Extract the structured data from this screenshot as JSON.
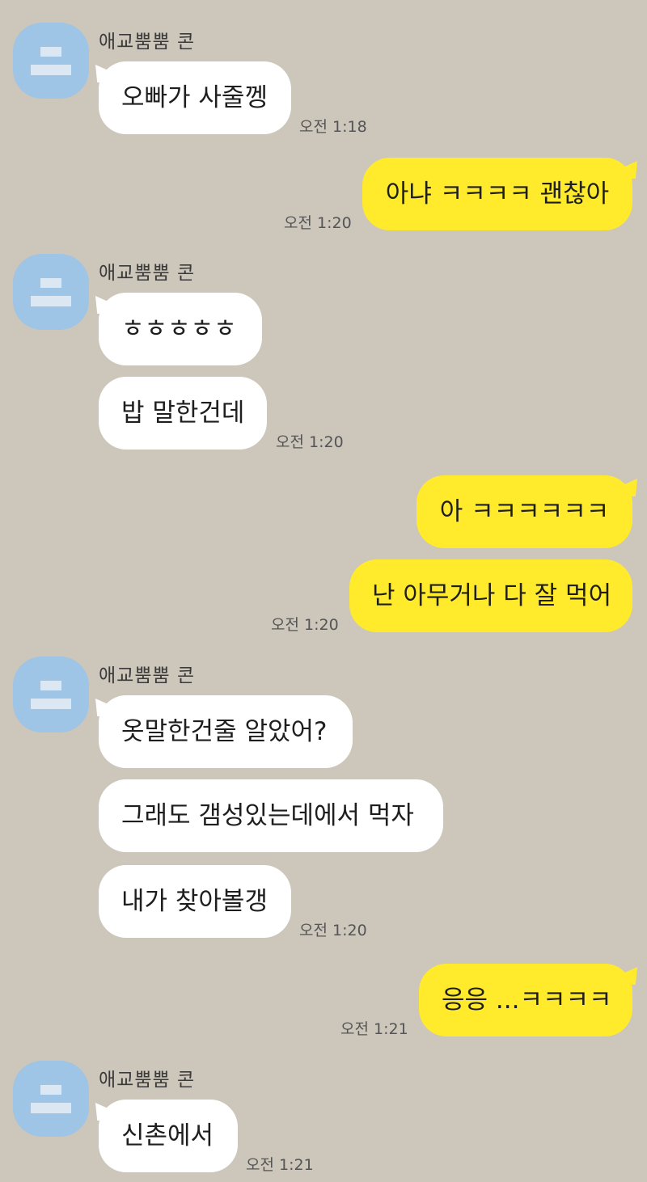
{
  "chat": {
    "sender_name": "애교뿜뿜 콘",
    "colors": {
      "background": "#ccc6bb",
      "incoming_bubble": "#ffffff",
      "outgoing_bubble": "#ffea2c",
      "avatar": "#9ec4e6"
    },
    "messages": [
      {
        "dir": "in",
        "text": "오빠가 사줄껭"
      },
      {
        "dir": "in_time",
        "text": "오전 1:18"
      },
      {
        "dir": "out",
        "text": "아냐 ㅋㅋㅋㅋ 괜찮아"
      },
      {
        "dir": "out_time",
        "text": "오전 1:20"
      },
      {
        "dir": "in",
        "text": "ㅎㅎㅎㅎㅎ"
      },
      {
        "dir": "in",
        "text": "밥 말한건데"
      },
      {
        "dir": "in_time",
        "text": "오전 1:20"
      },
      {
        "dir": "out",
        "text": "아 ㅋㅋㅋㅋㅋㅋ"
      },
      {
        "dir": "out",
        "text": "난 아무거나 다 잘 먹어"
      },
      {
        "dir": "out_time",
        "text": "오전 1:20"
      },
      {
        "dir": "in",
        "text": "옷말한건줄 알았어?"
      },
      {
        "dir": "in",
        "text": "그래도 갬성있는데에서 먹자"
      },
      {
        "dir": "in",
        "text": "내가 찾아볼갱"
      },
      {
        "dir": "in_time",
        "text": "오전 1:20"
      },
      {
        "dir": "out",
        "text": "응응 ...ㅋㅋㅋㅋ"
      },
      {
        "dir": "out_time",
        "text": "오전 1:21"
      },
      {
        "dir": "in",
        "text": "신촌에서"
      },
      {
        "dir": "in_time",
        "text": "오전 1:21"
      }
    ]
  }
}
